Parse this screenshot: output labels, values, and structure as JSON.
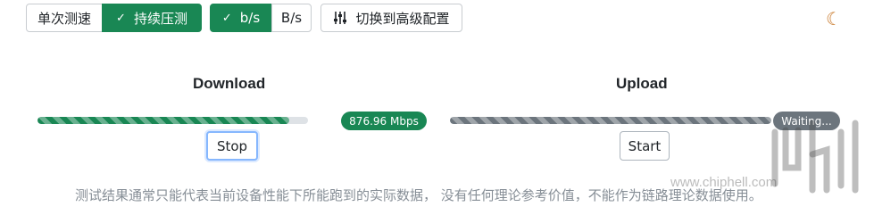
{
  "mode_toggle": {
    "single_label": "单次测速",
    "continuous_label": "持续压测",
    "active": "continuous"
  },
  "unit_toggle": {
    "bits_label": "b/s",
    "bytes_label": "B/s",
    "active": "bits"
  },
  "advanced_button": {
    "label": "切换到高级配置",
    "icon": "sliders-icon"
  },
  "theme_icon": "moon-icon",
  "download": {
    "title": "Download",
    "speed": "876.96 Mbps",
    "progress": 0.93,
    "button_label": "Stop",
    "color": "#198754"
  },
  "upload": {
    "title": "Upload",
    "status": "Waiting...",
    "progress": 1.0,
    "button_label": "Start",
    "color": "#6c757d"
  },
  "disclaimer": "测试结果通常只能代表当前设备性能下所能跑到的实际数据， 没有任何理论参考价值，不能作为链路理论数据使用。",
  "watermark": {
    "url": "www.chiphell.com"
  }
}
